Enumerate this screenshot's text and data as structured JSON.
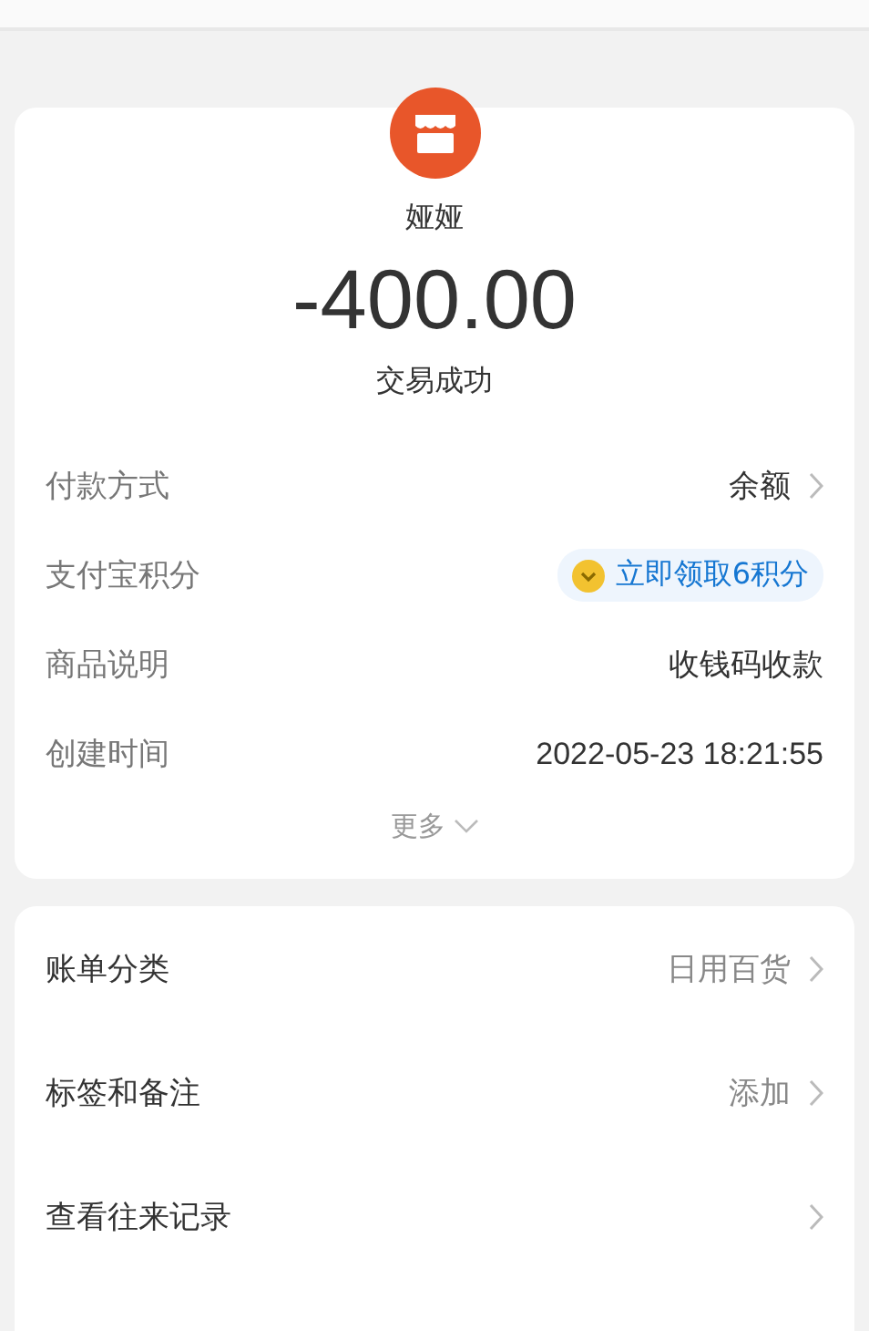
{
  "payee": {
    "name": "娅娅"
  },
  "amount": "-400.00",
  "status": "交易成功",
  "details": [
    {
      "kind": "link",
      "label": "付款方式",
      "value": "余额"
    },
    {
      "kind": "badge",
      "label": "支付宝积分",
      "value": "立即领取6积分"
    },
    {
      "kind": "plain",
      "label": "商品说明",
      "value": "收钱码收款"
    },
    {
      "kind": "plain",
      "label": "创建时间",
      "value": "2022-05-23 18:21:55"
    }
  ],
  "more": "更多",
  "actions": [
    {
      "label": "账单分类",
      "value": "日用百货"
    },
    {
      "label": "标签和备注",
      "value": "添加"
    },
    {
      "label": "查看往来记录"
    }
  ]
}
